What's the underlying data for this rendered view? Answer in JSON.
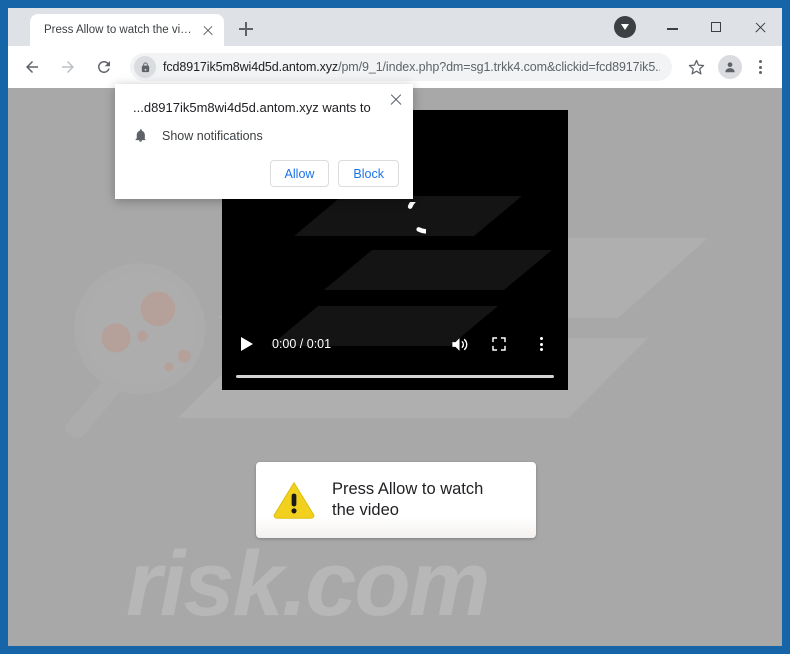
{
  "frame": {
    "border_color": "#1565a8"
  },
  "browser": {
    "tab": {
      "title": "Press Allow to watch the video",
      "close_icon": "close-icon"
    },
    "new_tab_label": "+",
    "window_controls": {
      "download_icon": "download-indicator-icon",
      "minimize": "minimize-icon",
      "maximize": "maximize-icon",
      "close": "close-icon"
    },
    "toolbar": {
      "back_icon": "back-arrow-icon",
      "forward_icon": "forward-arrow-icon",
      "reload_icon": "reload-icon",
      "lock_icon": "lock-icon",
      "url_host": "fcd8917ik5m8wi4d5d.antom.xyz",
      "url_path": "/pm/9_1/index.php?dm=sg1.trkk4.com&clickid=fcd8917ik5...",
      "url_full": "fcd8917ik5m8wi4d5d.antom.xyz/pm/9_1/index.php?dm=sg1.trkk4.com&clickid=fcd8917ik5...",
      "bookmark_icon": "star-icon",
      "profile_icon": "profile-avatar-icon",
      "menu_icon": "three-dot-menu-icon"
    }
  },
  "permission_dialog": {
    "title": "...d8917ik5m8wi4d5d.antom.xyz wants to",
    "option_icon": "bell-icon",
    "option_label": "Show notifications",
    "allow_label": "Allow",
    "block_label": "Block",
    "close_icon": "close-icon",
    "accent_color": "#1a73e8"
  },
  "page": {
    "background_color": "#a8a8a8",
    "video": {
      "background_color": "#000000",
      "spinner": "loading-spinner-icon",
      "play_icon": "play-icon",
      "time_display": "0:00 / 0:01",
      "current_time": "0:00",
      "duration": "0:01",
      "volume_icon": "volume-icon",
      "fullscreen_icon": "fullscreen-icon",
      "options_icon": "three-dot-menu-icon",
      "progress_percent": 0
    },
    "overlay_card": {
      "warning_icon": "warning-triangle-icon",
      "warning_color": "#f2d01e",
      "message_line1": "Press Allow to watch",
      "message_line2": "the video"
    },
    "watermark": {
      "logo_icon": "magnifier-logo-icon",
      "text": "risk.com",
      "color": "#b7b7b7"
    }
  }
}
